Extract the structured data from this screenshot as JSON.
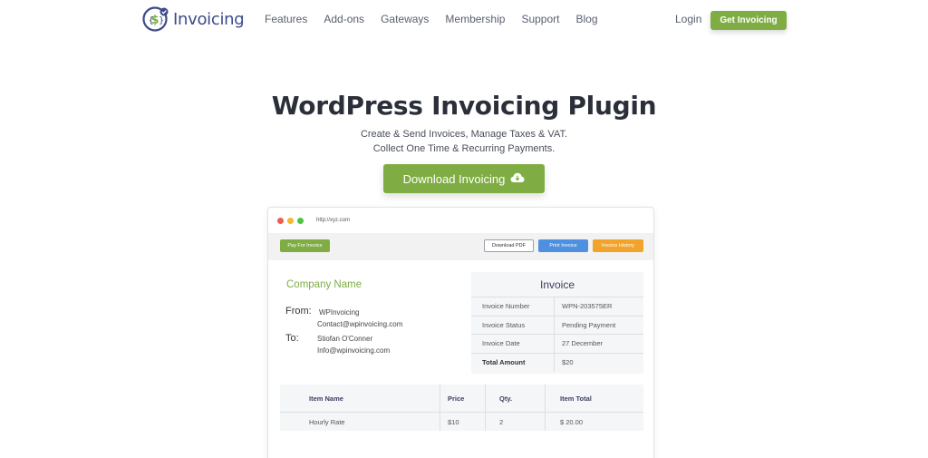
{
  "nav": {
    "brand": "Invoicing",
    "menu": [
      "Features",
      "Add-ons",
      "Gateways",
      "Membership",
      "Support",
      "Blog"
    ],
    "login": "Login",
    "cta": "Get Invoicing"
  },
  "hero": {
    "title": "WordPress Invoicing Plugin",
    "subtitle_line1": "Create & Send Invoices, Manage Taxes & VAT.",
    "subtitle_line2": "Collect One Time & Recurring Payments.",
    "button": "Download Invoicing"
  },
  "mockup": {
    "url": "http://xyz.com",
    "toolbar": {
      "pay": "Pay For Invoice",
      "pdf": "Download PDF",
      "print": "Print Invoice",
      "history": "Invoice History"
    },
    "company": "Company Name",
    "from_label": "From:",
    "to_label": "To:",
    "from_name": "WPInvoicing",
    "from_email": "Contact@wpinvoicing.com",
    "to_name": "Stiofan O'Conner",
    "to_email": "Info@wpinvoicing.com",
    "invoice": {
      "title": "Invoice",
      "rows": [
        {
          "key": "Invoice Number",
          "value": "WPN-203575ER"
        },
        {
          "key": "Invoice Status",
          "value": "Pending Payment"
        },
        {
          "key": "Invoice Date",
          "value": "27 December"
        },
        {
          "key": "Total Amount",
          "value": "$20"
        }
      ]
    },
    "items": {
      "headers": [
        "Item Name",
        "Price",
        "Qty.",
        "Item Total"
      ],
      "rows": [
        [
          "Hourly Rate",
          "$10",
          "2",
          "$ 20.00"
        ]
      ]
    }
  },
  "colors": {
    "accent_green": "#7fad43",
    "brand_navy": "#3d4a8a",
    "print_blue": "#4f8fe0",
    "history_orange": "#f2a32b"
  }
}
